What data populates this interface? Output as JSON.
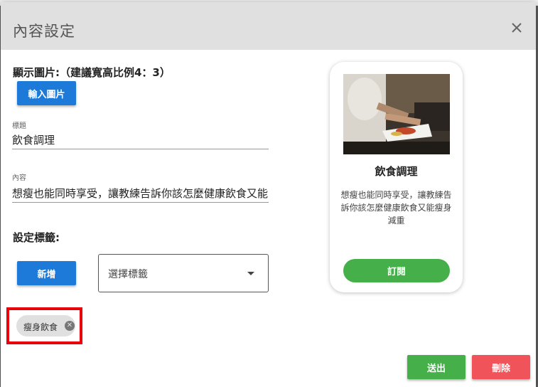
{
  "dialog": {
    "title": "內容設定",
    "close_icon": "close-icon"
  },
  "image_section": {
    "label": "顯示圖片:（建議寬高比例4：3）",
    "upload_label": "輸入圖片"
  },
  "title_field": {
    "caption": "標題",
    "value": "飲食調理"
  },
  "content_field": {
    "caption": "內容",
    "value": "想瘦也能同時享受，讓教練告訴你該怎麼健康飲食又能"
  },
  "tags": {
    "label": "設定標籤:",
    "add_label": "新增",
    "select_placeholder": "選擇標籤",
    "chips": [
      {
        "label": "瘦身飲食",
        "remove_icon": "cancel-circle-icon"
      }
    ]
  },
  "preview_card": {
    "title": "飲食調理",
    "description": "想瘦也能同時享受，讓教練告訴你該怎麼健康飲食又能瘦身減重",
    "subscribe_label": "訂閱"
  },
  "footer": {
    "submit_label": "送出",
    "delete_label": "刪除"
  },
  "colors": {
    "primary_blue": "#1e7ad8",
    "green": "#45b04a",
    "red": "#f0545a",
    "highlight_red": "#e8000b"
  }
}
